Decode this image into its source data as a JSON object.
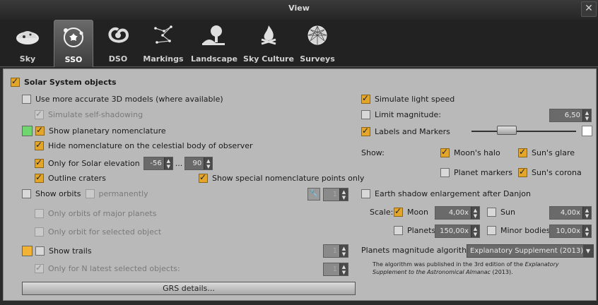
{
  "window": {
    "title": "View",
    "close": "✕"
  },
  "tabs": [
    {
      "label": "Sky"
    },
    {
      "label": "SSO"
    },
    {
      "label": "DSO"
    },
    {
      "label": "Markings"
    },
    {
      "label": "Landscape"
    },
    {
      "label": "Sky Culture"
    },
    {
      "label": "Surveys"
    }
  ],
  "left": {
    "solar_system": "Solar System objects",
    "accurate_3d": "Use more accurate 3D models (where available)",
    "self_shadowing": "Simulate self-shadowing",
    "planetary_nomenclature": "Show planetary nomenclature",
    "hide_nomenclature": "Hide nomenclature on the celestial body of observer",
    "solar_elevation": "Only for Solar elevation",
    "elev_min": "-56",
    "elev_sep": "...",
    "elev_max": "90",
    "outline_craters": "Outline craters",
    "special_points": "Show special nomenclature points only",
    "show_orbits": "Show orbits",
    "permanently": "permanently",
    "orbits_major": "Only orbits of major planets",
    "orbit_selected": "Only orbit for selected object",
    "show_trails": "Show trails",
    "n_latest": "Only for N latest selected objects:",
    "grs": "GRS details...",
    "orbit_spin": "1",
    "trail_spin": "1",
    "n_spin": "1"
  },
  "right": {
    "light_speed": "Simulate light speed",
    "limit_mag": "Limit magnitude:",
    "limit_mag_value": "6,50",
    "labels_markers": "Labels and Markers",
    "show": "Show:",
    "moons_halo": "Moon's halo",
    "suns_glare": "Sun's glare",
    "planet_markers": "Planet markers",
    "suns_corona": "Sun's corona",
    "earth_shadow": "Earth shadow enlargement after Danjon",
    "scale": "Scale:",
    "moon": "Moon",
    "moon_val": "4,00x",
    "sun": "Sun",
    "sun_val": "4,00x",
    "planets": "Planets",
    "planets_val": "150,00x",
    "minor_bodies": "Minor bodies",
    "minor_val": "10,00x",
    "mag_algorithm": "Planets magnitude algorithm:",
    "mag_algorithm_value": "Explanatory Supplement (2013)",
    "note_a": "The algorithm was published in the 3rd edition of the ",
    "note_b": "Explanatory Supplement to the Astronomical Almanac",
    "note_c": " (2013)."
  },
  "colors": {
    "nomenclature": "#6fd66f",
    "trails": "#f2b233"
  }
}
